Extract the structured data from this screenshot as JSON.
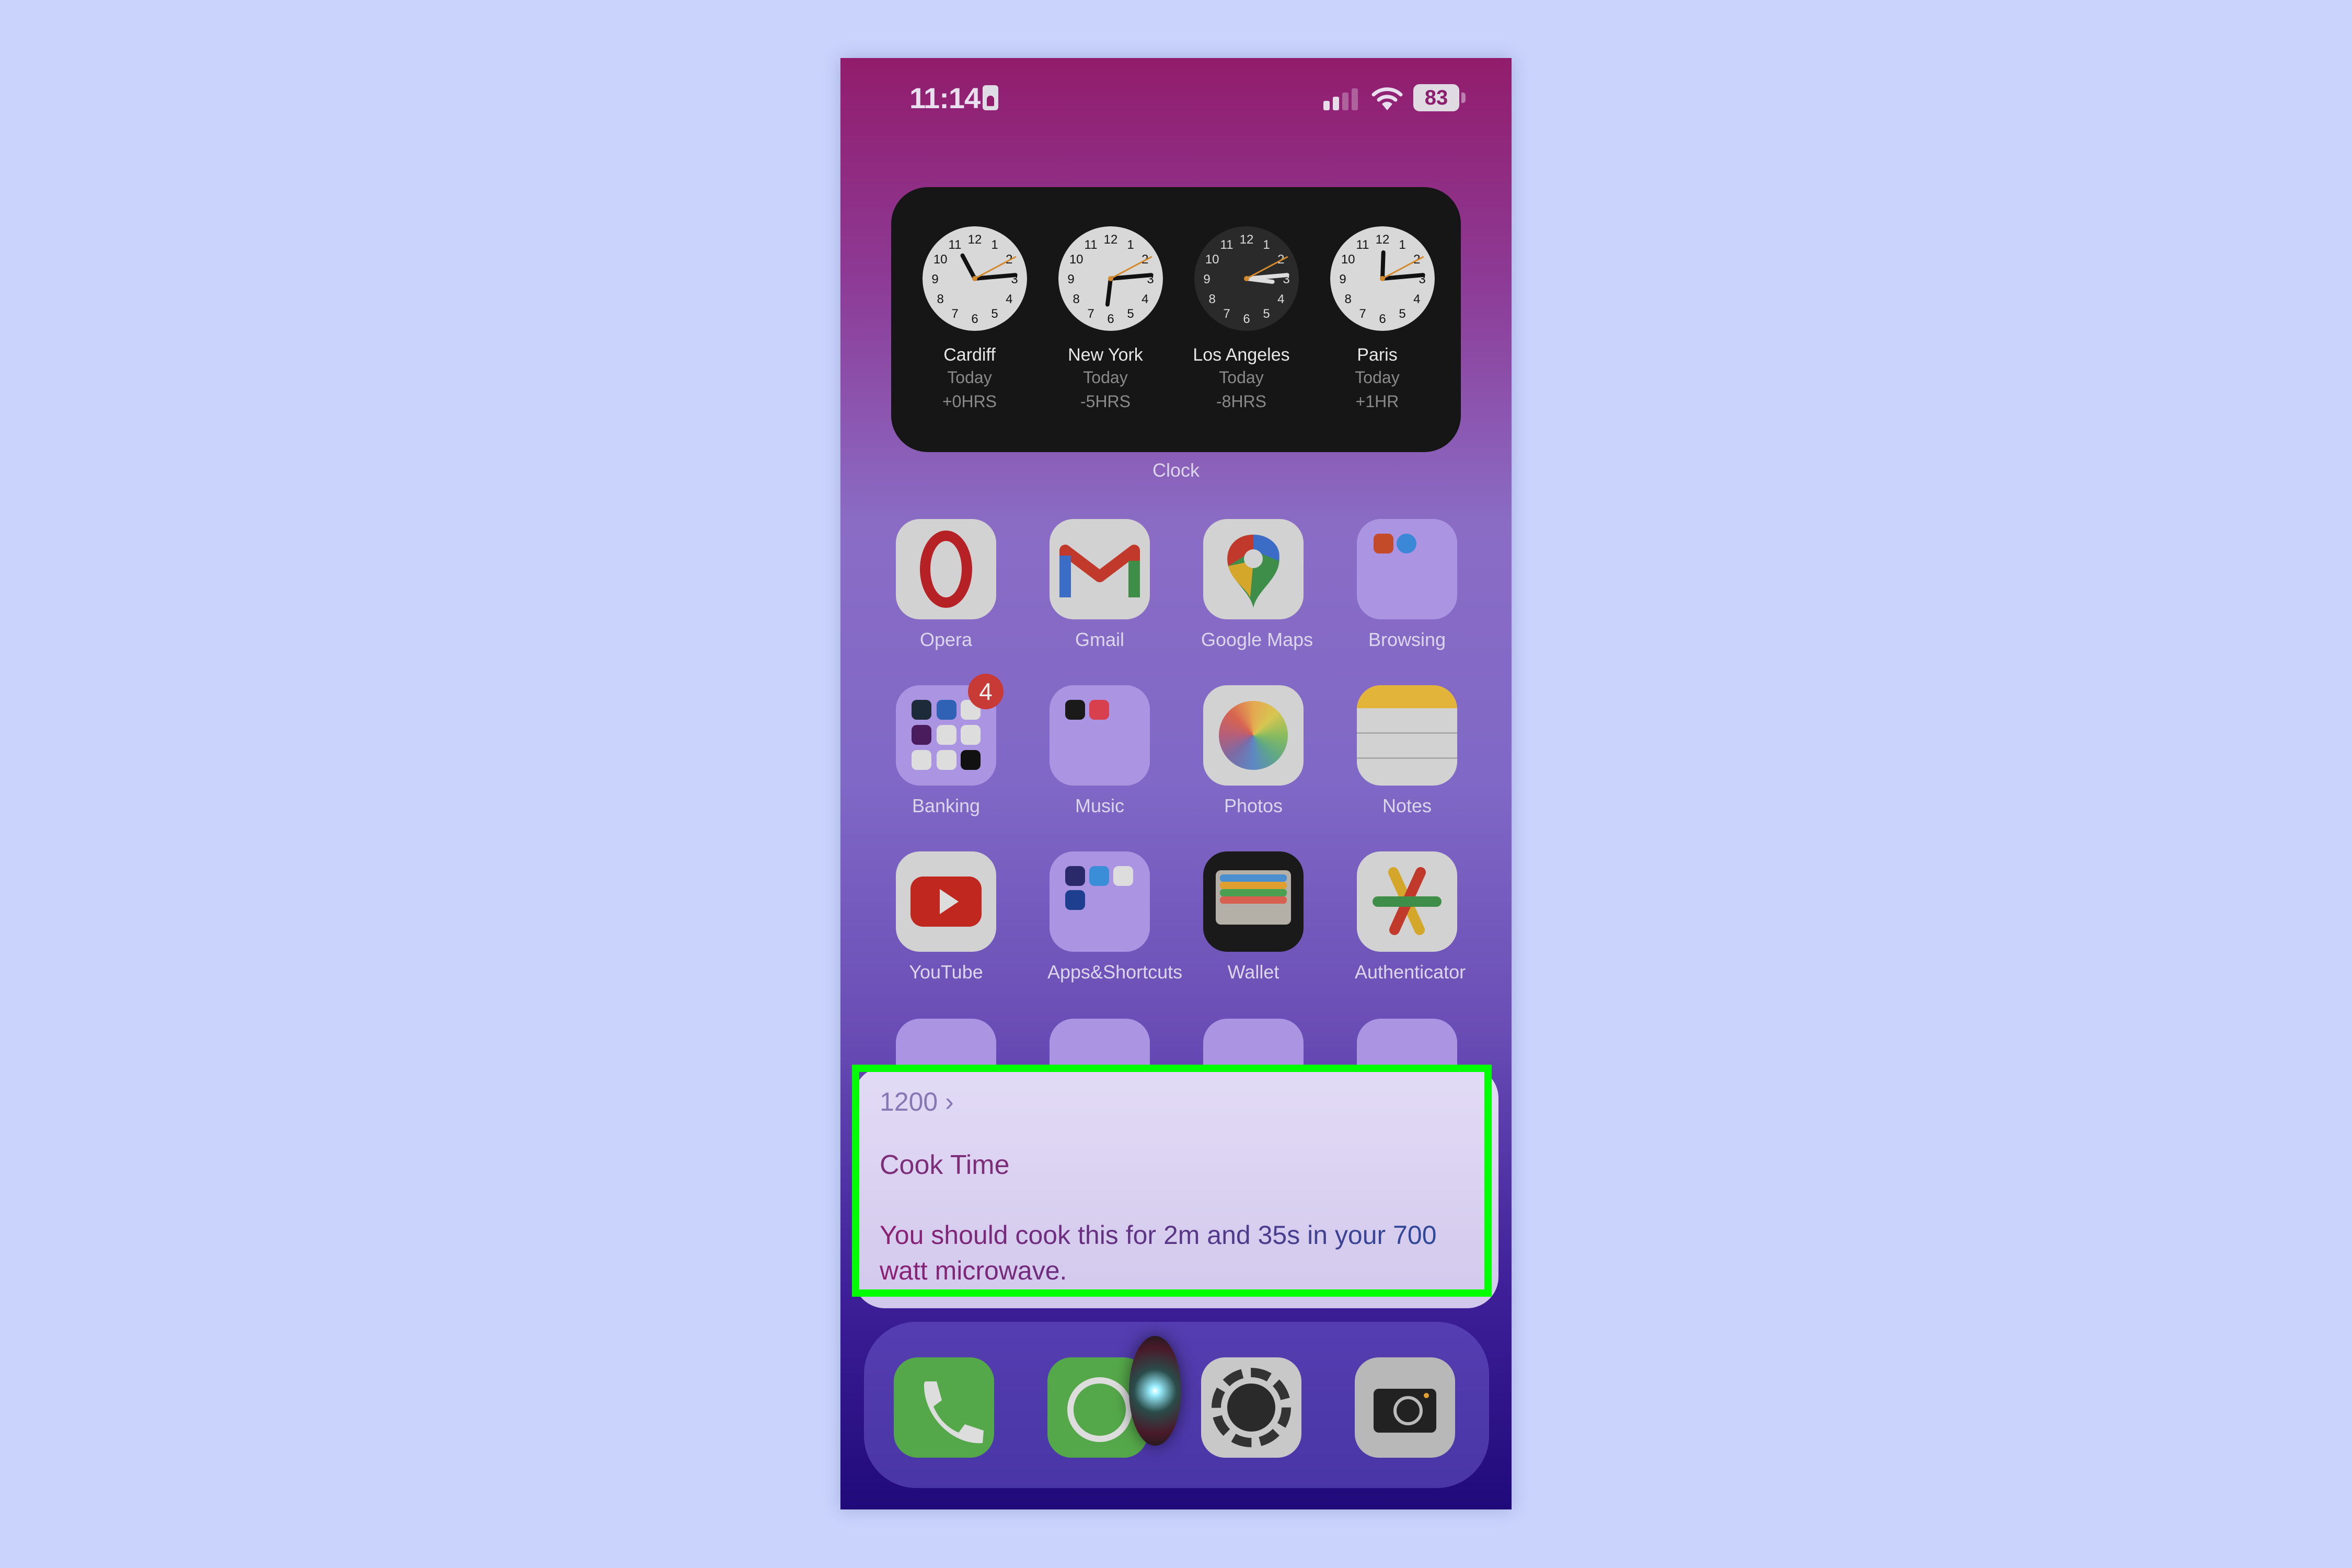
{
  "status_bar": {
    "time": "11:14",
    "battery": "83"
  },
  "clock_widget": {
    "label": "Clock",
    "cities": [
      {
        "name": "Cardiff",
        "day": "Today",
        "offset": "+0HRS",
        "dark": false,
        "hour_deg": 332,
        "min_deg": 85,
        "sec_deg": 62
      },
      {
        "name": "New York",
        "day": "Today",
        "offset": "-5HRS",
        "dark": false,
        "hour_deg": 187,
        "min_deg": 85,
        "sec_deg": 62
      },
      {
        "name": "Los Angeles",
        "day": "Today",
        "offset": "-8HRS",
        "dark": true,
        "hour_deg": 97,
        "min_deg": 85,
        "sec_deg": 62
      },
      {
        "name": "Paris",
        "day": "Today",
        "offset": "+1HR",
        "dark": false,
        "hour_deg": 2,
        "min_deg": 85,
        "sec_deg": 62
      }
    ]
  },
  "apps": {
    "row1": [
      "Opera",
      "Gmail",
      "Google Maps",
      "Browsing"
    ],
    "row2": [
      "Banking",
      "Music",
      "Photos",
      "Notes"
    ],
    "row3": [
      "YouTube",
      "Apps&Shortcuts",
      "Wallet",
      "Authenticator"
    ],
    "banking_badge": "4"
  },
  "siri_card": {
    "source": "1200",
    "title": "Cook Time",
    "body": "You should cook this for 2m and 35s in your 700 watt microwave."
  },
  "dock": [
    "Phone",
    "WhatsApp",
    "Settings",
    "Camera"
  ]
}
